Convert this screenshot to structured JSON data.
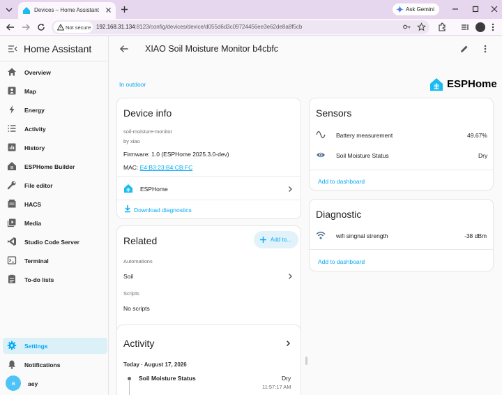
{
  "browser": {
    "tab_title": "Devices – Home Assistant",
    "security_chip": "Not secure",
    "url_host": "192.168.31.134",
    "url_path": ":8123/config/devices/device/d055d6d3c09724456ee3e62de8a8f5cb",
    "gemini_label": "Ask Gemini"
  },
  "sidebar": {
    "app_name": "Home Assistant",
    "items": [
      {
        "label": "Overview",
        "icon": "home-icon"
      },
      {
        "label": "Map",
        "icon": "map-icon"
      },
      {
        "label": "Energy",
        "icon": "lightning-icon"
      },
      {
        "label": "Activity",
        "icon": "list-icon"
      },
      {
        "label": "History",
        "icon": "chart-icon"
      },
      {
        "label": "ESPHome Builder",
        "icon": "esphome-icon"
      },
      {
        "label": "File editor",
        "icon": "wrench-icon"
      },
      {
        "label": "HACS",
        "icon": "hacs-icon"
      },
      {
        "label": "Media",
        "icon": "media-icon"
      },
      {
        "label": "Studio Code Server",
        "icon": "vscode-icon"
      },
      {
        "label": "Terminal",
        "icon": "terminal-icon"
      },
      {
        "label": "To-do lists",
        "icon": "todo-icon"
      }
    ],
    "settings": "Settings",
    "notifications": "Notifications",
    "user_initial": "a",
    "user_name": "aey"
  },
  "page": {
    "title": "XIAO Soil Moisture Monitor b4cbfc",
    "area": "In outdoor",
    "brand": "ESPHome",
    "accent": "#03a9f4"
  },
  "device_info": {
    "heading": "Device info",
    "model": "soil-moisture-monitor",
    "manufacturer": "by xiao",
    "firmware": "Firmware: 1.0 (ESPHome 2025.3.0-dev)",
    "mac_label": "MAC: ",
    "mac_value": "E4:B3:23:B4:CB:FC",
    "integration": "ESPHome",
    "download": "Download diagnostics"
  },
  "related": {
    "heading": "Related",
    "add_button": "Add to...",
    "automations_label": "Automations",
    "automation_item": "Soil",
    "scripts_label": "Scripts",
    "scripts_value": "No scripts"
  },
  "activity": {
    "heading": "Activity",
    "date": "Today · August 17, 2026",
    "entries": [
      {
        "name": "Soil Moisture Status",
        "state": "Dry",
        "time": "11:57:17 AM"
      }
    ]
  },
  "sensors": {
    "heading": "Sensors",
    "rows": [
      {
        "name": "Battery measurement",
        "value": "49.67%",
        "icon": "sine-wave-icon"
      },
      {
        "name": "Soil Moisture Status",
        "value": "Dry",
        "icon": "eye-icon"
      }
    ],
    "add_to_dashboard": "Add to dashboard"
  },
  "diagnostic": {
    "heading": "Diagnostic",
    "rows": [
      {
        "name": "wifi singnal strength",
        "value": "-38 dBm",
        "icon": "wifi-icon"
      }
    ],
    "add_to_dashboard": "Add to dashboard"
  }
}
